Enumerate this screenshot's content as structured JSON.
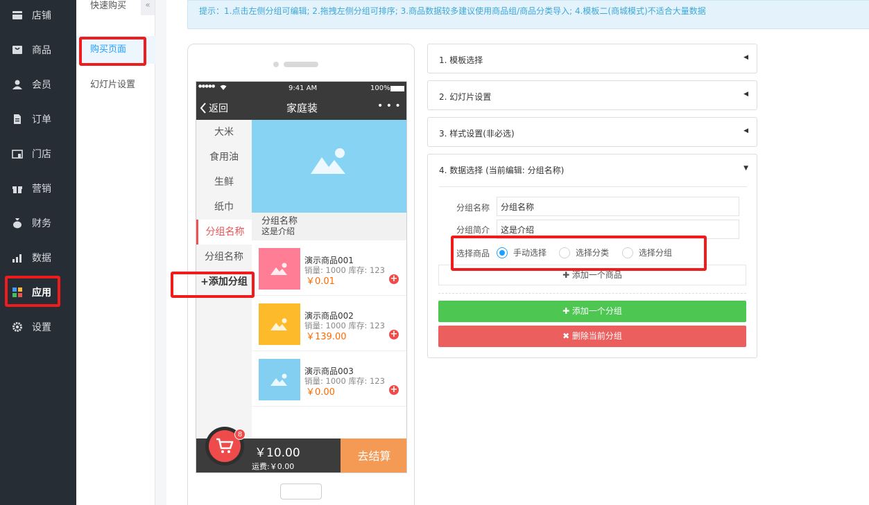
{
  "nav": {
    "items": [
      {
        "label": "店铺",
        "icon": "store-icon"
      },
      {
        "label": "商品",
        "icon": "goods-icon"
      },
      {
        "label": "会员",
        "icon": "member-icon"
      },
      {
        "label": "订单",
        "icon": "order-icon"
      },
      {
        "label": "门店",
        "icon": "shop-icon"
      },
      {
        "label": "营销",
        "icon": "gift-icon"
      },
      {
        "label": "财务",
        "icon": "money-bag-icon"
      },
      {
        "label": "数据",
        "icon": "chart-icon"
      },
      {
        "label": "应用",
        "icon": "apps-icon"
      },
      {
        "label": "设置",
        "icon": "gear-icon"
      }
    ],
    "active_index": 8
  },
  "subnav": {
    "title": "快速购买",
    "collapse_glyph": "«",
    "items": [
      "购买页面",
      "幻灯片设置"
    ]
  },
  "tip": "提示：1.点击左侧分组可编辑; 2.拖拽左侧分组可排序; 3.商品数据较多建议使用商品组/商品分类导入; 4.模板二(商城模式)不适合大量数据",
  "phone": {
    "status": {
      "signal": "●●●●●",
      "time": "9:41 AM",
      "battery": "100%"
    },
    "nav": {
      "back": "返回",
      "title": "家庭装",
      "more": "• • •"
    },
    "categories": [
      "大米",
      "食用油",
      "生鲜",
      "纸巾",
      "分组名称",
      "分组名称"
    ],
    "active_category": 4,
    "add_group": "+添加分组",
    "group": {
      "name": "分组名称",
      "intro": "这是介绍"
    },
    "products": [
      {
        "name": "演示商品001",
        "stats": "销量: 1000 库存: 123",
        "price": "￥0.01",
        "color": "#ff7e95"
      },
      {
        "name": "演示商品002",
        "stats": "销量: 1000 库存: 123",
        "price": "￥139.00",
        "color": "#fdbb2c"
      },
      {
        "name": "演示商品003",
        "stats": "销量: 1000 库存: 123",
        "price": "￥0.00",
        "color": "#82cff1"
      }
    ],
    "cart": {
      "badge": "8",
      "total": "￥10.00",
      "shipping": "运费:￥0.00",
      "checkout": "去结算"
    }
  },
  "accordion": [
    {
      "title": "1. 模板选择",
      "arrow": "◀"
    },
    {
      "title": "2. 幻灯片设置",
      "arrow": "◀"
    },
    {
      "title": "3. 样式设置(非必选)",
      "arrow": "◀"
    }
  ],
  "data_panel": {
    "title": "4. 数据选择 (当前编辑: 分组名称)",
    "arrow": "▼",
    "name_label": "分组名称",
    "name_value": "分组名称",
    "intro_label": "分组简介",
    "intro_value": "这是介绍",
    "select_label": "选择商品",
    "options": [
      "手动选择",
      "选择分类",
      "选择分组"
    ],
    "selected_option": 0,
    "add_product": "✚ 添加一个商品",
    "add_group": "✚ 添加一个分组",
    "delete_group": "✖ 删除当前分组"
  },
  "colors": {
    "sidebar": "#262d35",
    "accent": "#1e9fff",
    "highlight": "#ee1c1c",
    "green": "#4dc752",
    "red": "#eb5f5f",
    "price": "#ff6a00"
  }
}
